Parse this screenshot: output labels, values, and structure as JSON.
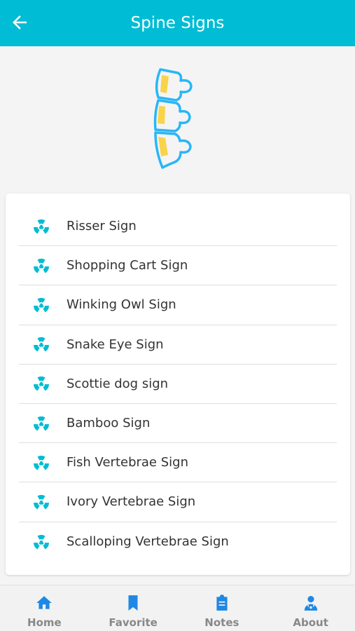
{
  "header": {
    "title": "Spine Signs",
    "back_icon": "arrow-left-icon"
  },
  "hero": {
    "icon": "spine-illustration"
  },
  "list": {
    "items": [
      {
        "label": "Risser Sign",
        "icon": "radiation-icon"
      },
      {
        "label": "Shopping Cart Sign",
        "icon": "radiation-icon"
      },
      {
        "label": "Winking Owl Sign",
        "icon": "radiation-icon"
      },
      {
        "label": "Snake Eye Sign",
        "icon": "radiation-icon"
      },
      {
        "label": "Scottie dog sign",
        "icon": "radiation-icon"
      },
      {
        "label": "Bamboo Sign",
        "icon": "radiation-icon"
      },
      {
        "label": "Fish Vertebrae Sign",
        "icon": "radiation-icon"
      },
      {
        "label": "Ivory Vertebrae Sign",
        "icon": "radiation-icon"
      },
      {
        "label": "Scalloping Vertebrae Sign",
        "icon": "radiation-icon"
      }
    ]
  },
  "bottom_nav": {
    "items": [
      {
        "label": "Home",
        "icon": "home-icon"
      },
      {
        "label": "Favorite",
        "icon": "bookmark-icon"
      },
      {
        "label": "Notes",
        "icon": "clipboard-icon"
      },
      {
        "label": "About",
        "icon": "doctor-icon"
      }
    ]
  },
  "colors": {
    "primary": "#00bcd4",
    "icon_blue": "#1e88e5",
    "spine_outline": "#29b6f6",
    "spine_disc": "#f9d349",
    "list_icon": "#00bcd4",
    "background": "#f4f4f4"
  }
}
